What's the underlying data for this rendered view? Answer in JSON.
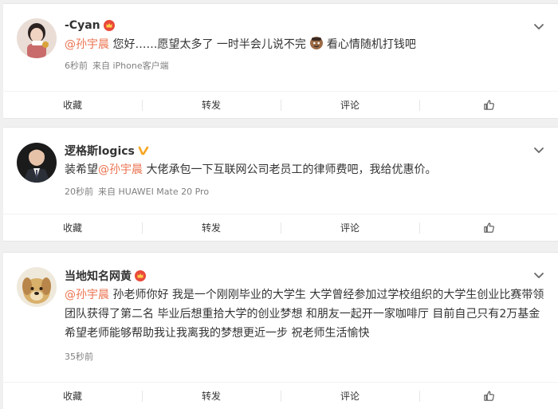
{
  "posts": [
    {
      "username": "-Cyan",
      "text_mention": "@孙宇晨",
      "text_rest": " 您好……愿望太多了 一时半会儿说不完",
      "text_tail": "看心情随机打钱吧",
      "time": "6秒前",
      "source": "来自 iPhone客户端",
      "badge": "crown-badge-icon"
    },
    {
      "username": "逻格斯logics",
      "text_prefix": "装希望",
      "text_mention": "@孙宇晨",
      "text_rest": " 大佬承包一下互联网公司老员工的律师费吧，我给优惠价。",
      "time": "20秒前",
      "source": "来自 HUAWEI Mate 20 Pro",
      "badge": "verified-v-icon"
    },
    {
      "username": "当地知名网黄",
      "text_mention": "@孙宇晨",
      "text_rest": " 孙老师你好 我是一个刚刚毕业的大学生 大学曾经参加过学校组织的大学生创业比赛带领团队获得了第二名 毕业后想重拾大学的创业梦想 和朋友一起开一家咖啡厅 目前自己只有2万基金 希望老师能够帮助我让我离我的梦想更近一步 祝老师生活愉快",
      "time": "35秒前",
      "badge": "crown-badge-icon"
    }
  ],
  "actions": {
    "collect": "收藏",
    "repost": "转发",
    "comment": "评论"
  },
  "colors": {
    "mention": "#eb7350",
    "badge_gold": "#f5a623",
    "badge_red": "#e8493a"
  }
}
